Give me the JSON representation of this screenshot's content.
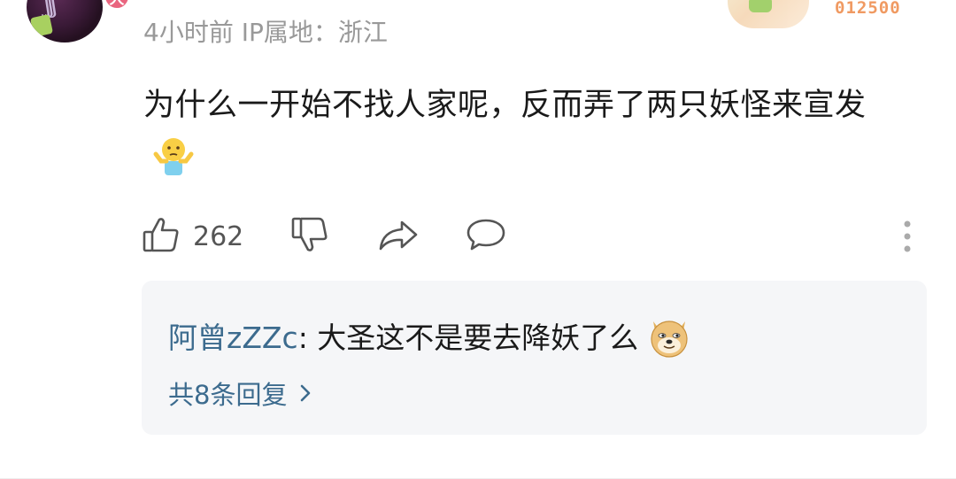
{
  "comment": {
    "author_badge": "大",
    "meta": "4小时前 IP属地：浙江",
    "text": "为什么一开始不找人家呢，反而弄了两只妖怪来宣发",
    "emoji": "shrug-emoji",
    "like_count": "262"
  },
  "decoration": {
    "number": "012500"
  },
  "reply_preview": {
    "author": "阿曾zZZc",
    "separator": ": ",
    "text": "大圣这不是要去降妖了么",
    "emoji": "doge-emoji",
    "more_label": "共8条回复"
  },
  "colors": {
    "link": "#3c6b8e",
    "meta": "#999999",
    "text": "#1a1a1a",
    "reply_bg": "#f5f6f8",
    "badge": "#e9657f"
  }
}
